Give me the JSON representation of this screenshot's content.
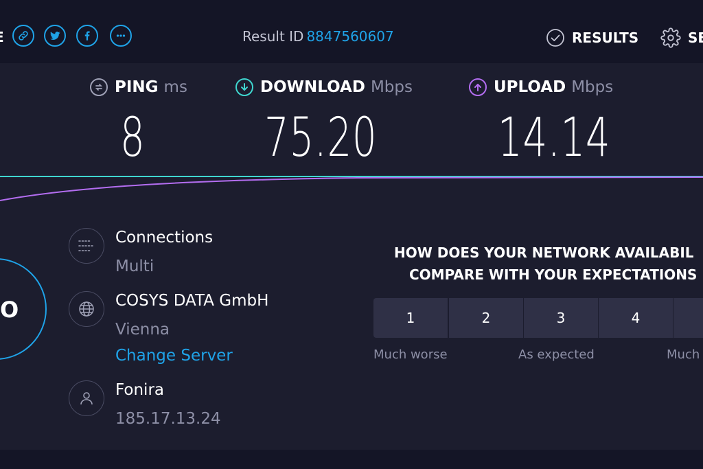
{
  "header": {
    "share_label": "E",
    "result_id_label": "Result ID",
    "result_id_value": "8847560607",
    "results_label": "RESULTS",
    "settings_label": "SE"
  },
  "metrics": {
    "ping": {
      "label": "PING",
      "unit": "ms",
      "value": "8"
    },
    "download": {
      "label": "DOWNLOAD",
      "unit": "Mbps",
      "value": "75.20"
    },
    "upload": {
      "label": "UPLOAD",
      "unit": "Mbps",
      "value": "14.14"
    }
  },
  "gauge": {
    "label": "O"
  },
  "connection": {
    "title": "Connections",
    "value": "Multi"
  },
  "server": {
    "name": "COSYS DATA GmbH",
    "location": "Vienna",
    "change_label": "Change Server"
  },
  "provider": {
    "name": "Fonira",
    "ip": "185.17.13.24"
  },
  "survey": {
    "line1": "HOW DOES YOUR NETWORK AVAILABIL",
    "line2": "COMPARE WITH YOUR EXPECTATIONS",
    "ratings": [
      "1",
      "2",
      "3",
      "4",
      ""
    ],
    "scale_low": "Much worse",
    "scale_mid": "As expected",
    "scale_high": "Much"
  },
  "colors": {
    "background": "#1c1d2e",
    "bar": "#141526",
    "accent_blue": "#1fa3e8",
    "download_cyan": "#3fd6cf",
    "upload_purple": "#b36df0",
    "muted": "#8d8fa6"
  }
}
